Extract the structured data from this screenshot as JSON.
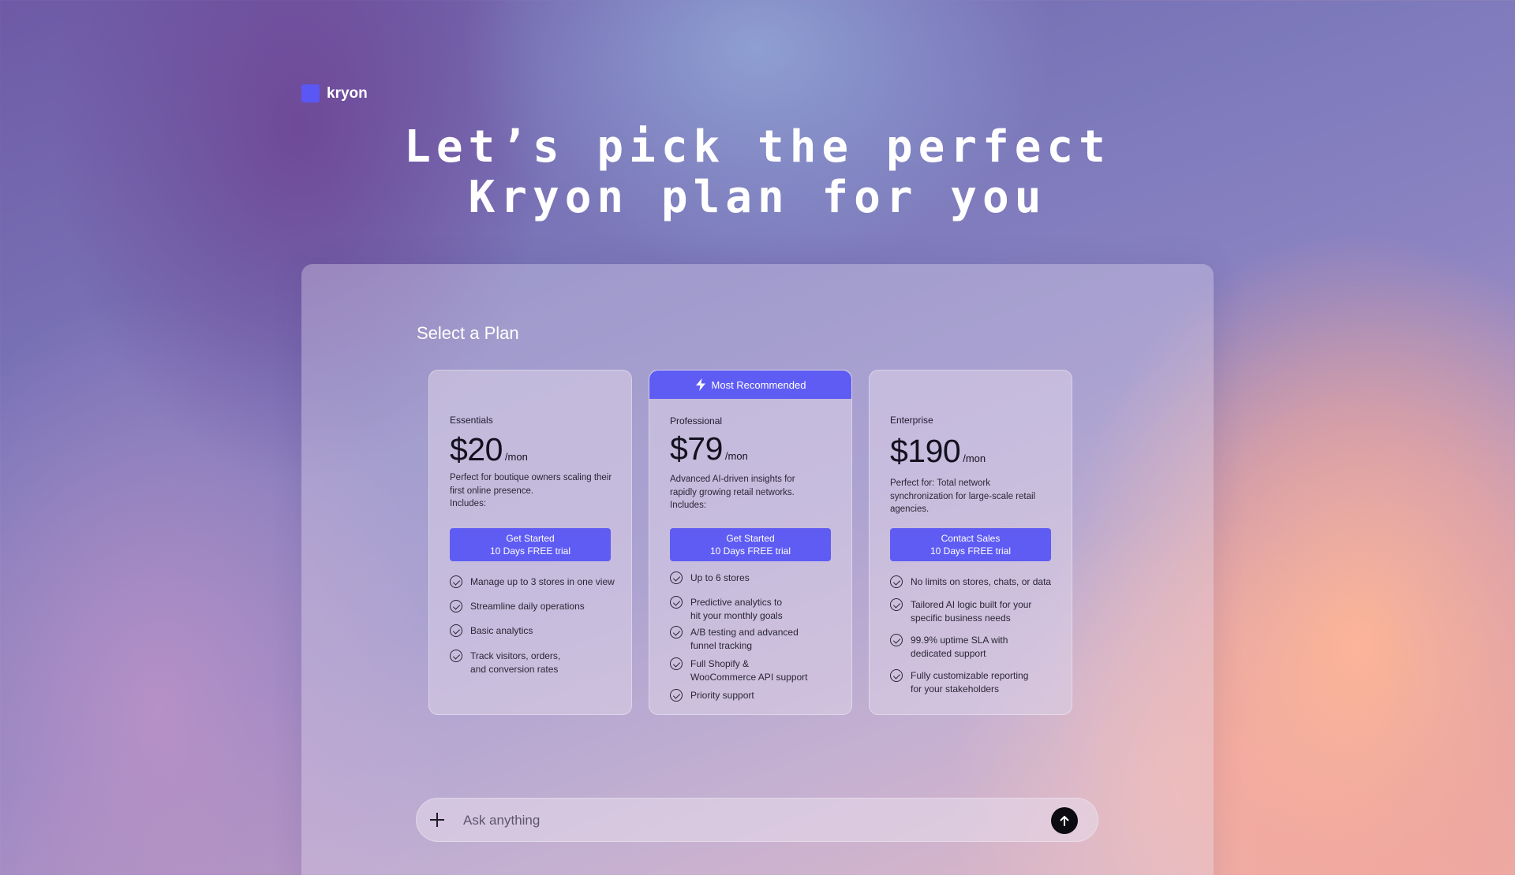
{
  "brand": {
    "name": "kryon",
    "accent": "#5b57f5"
  },
  "hero": {
    "line1": "Let’s pick the perfect",
    "line2": "Kryon plan for you"
  },
  "section": {
    "title": "Select a Plan"
  },
  "plans": [
    {
      "name": "Essentials",
      "price": "$20",
      "period": "/mon",
      "description": [
        "Perfect for boutique owners scaling their",
        "first online presence.",
        "Includes:"
      ],
      "button": {
        "line1": "Get Started",
        "line2": "10 Days FREE trial"
      },
      "features": [
        "Manage up to 3 stores in one view",
        "Streamline daily operations",
        "Basic analytics",
        "Track visitors, orders,\nand conversion rates"
      ]
    },
    {
      "badge": "Most Recommended",
      "badge_icon": "lightning-icon",
      "name": "Professional",
      "price": "$79",
      "period": "/mon",
      "description": [
        "Advanced AI-driven insights for",
        "rapidly growing retail networks.",
        "Includes:"
      ],
      "button": {
        "line1": "Get Started",
        "line2": "10 Days FREE trial"
      },
      "features": [
        "Up to 6 stores",
        "Predictive analytics to\nhit your monthly goals",
        "A/B testing and advanced\nfunnel tracking",
        "Full Shopify &\nWooCommerce API support",
        "Priority support"
      ]
    },
    {
      "name": "Enterprise",
      "price": "$190",
      "period": "/mon",
      "description": [
        "Perfect for: Total network",
        "synchronization for large-scale retail",
        "agencies."
      ],
      "button": {
        "line1": "Contact Sales",
        "line2": "10 Days FREE trial"
      },
      "features": [
        "No limits on stores, chats, or data",
        "Tailored AI logic built for your\nspecific business needs",
        "99.9% uptime SLA with\ndedicated support",
        "Fully customizable reporting\nfor your stakeholders"
      ]
    }
  ],
  "chat": {
    "placeholder": "Ask anything",
    "attach_icon": "plus-icon",
    "send_icon": "arrow-up-icon"
  },
  "colors": {
    "button": "#5f5cf4",
    "send_button": "#0d0b12"
  }
}
